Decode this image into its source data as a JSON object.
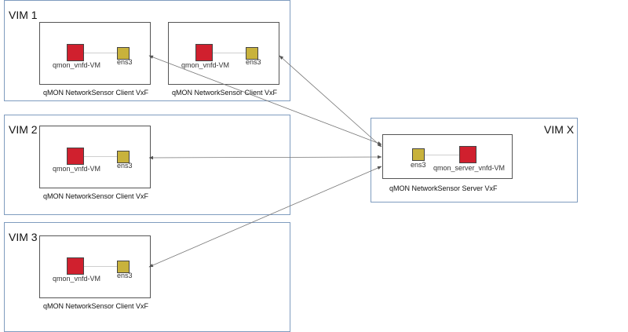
{
  "colors": {
    "vim_border": "#7f9cbf",
    "vm_fill": "#d0202e",
    "port_fill": "#c8b23c",
    "arrow": "#555555"
  },
  "vims": [
    {
      "title": "VIM 1",
      "vxfs": [
        {
          "label": "qMON NetworkSensor Client VxF",
          "vm": "qmon_vnfd-VM",
          "port": "ens3"
        },
        {
          "label": "qMON NetworkSensor Client VxF",
          "vm": "qmon_vnfd-VM",
          "port": "ens3"
        }
      ]
    },
    {
      "title": "VIM 2",
      "vxfs": [
        {
          "label": "qMON NetworkSensor Client VxF",
          "vm": "qmon_vnfd-VM",
          "port": "ens3"
        }
      ]
    },
    {
      "title": "VIM 3",
      "vxfs": [
        {
          "label": "qMON NetworkSensor Client VxF",
          "vm": "qmon_vnfd-VM",
          "port": "ens3"
        }
      ]
    },
    {
      "title": "VIM X",
      "vxfs": [
        {
          "label": "qMON NetworkSensor Server VxF",
          "vm": "qmon_server_vnfd-VM",
          "port": "ens3"
        }
      ]
    }
  ]
}
